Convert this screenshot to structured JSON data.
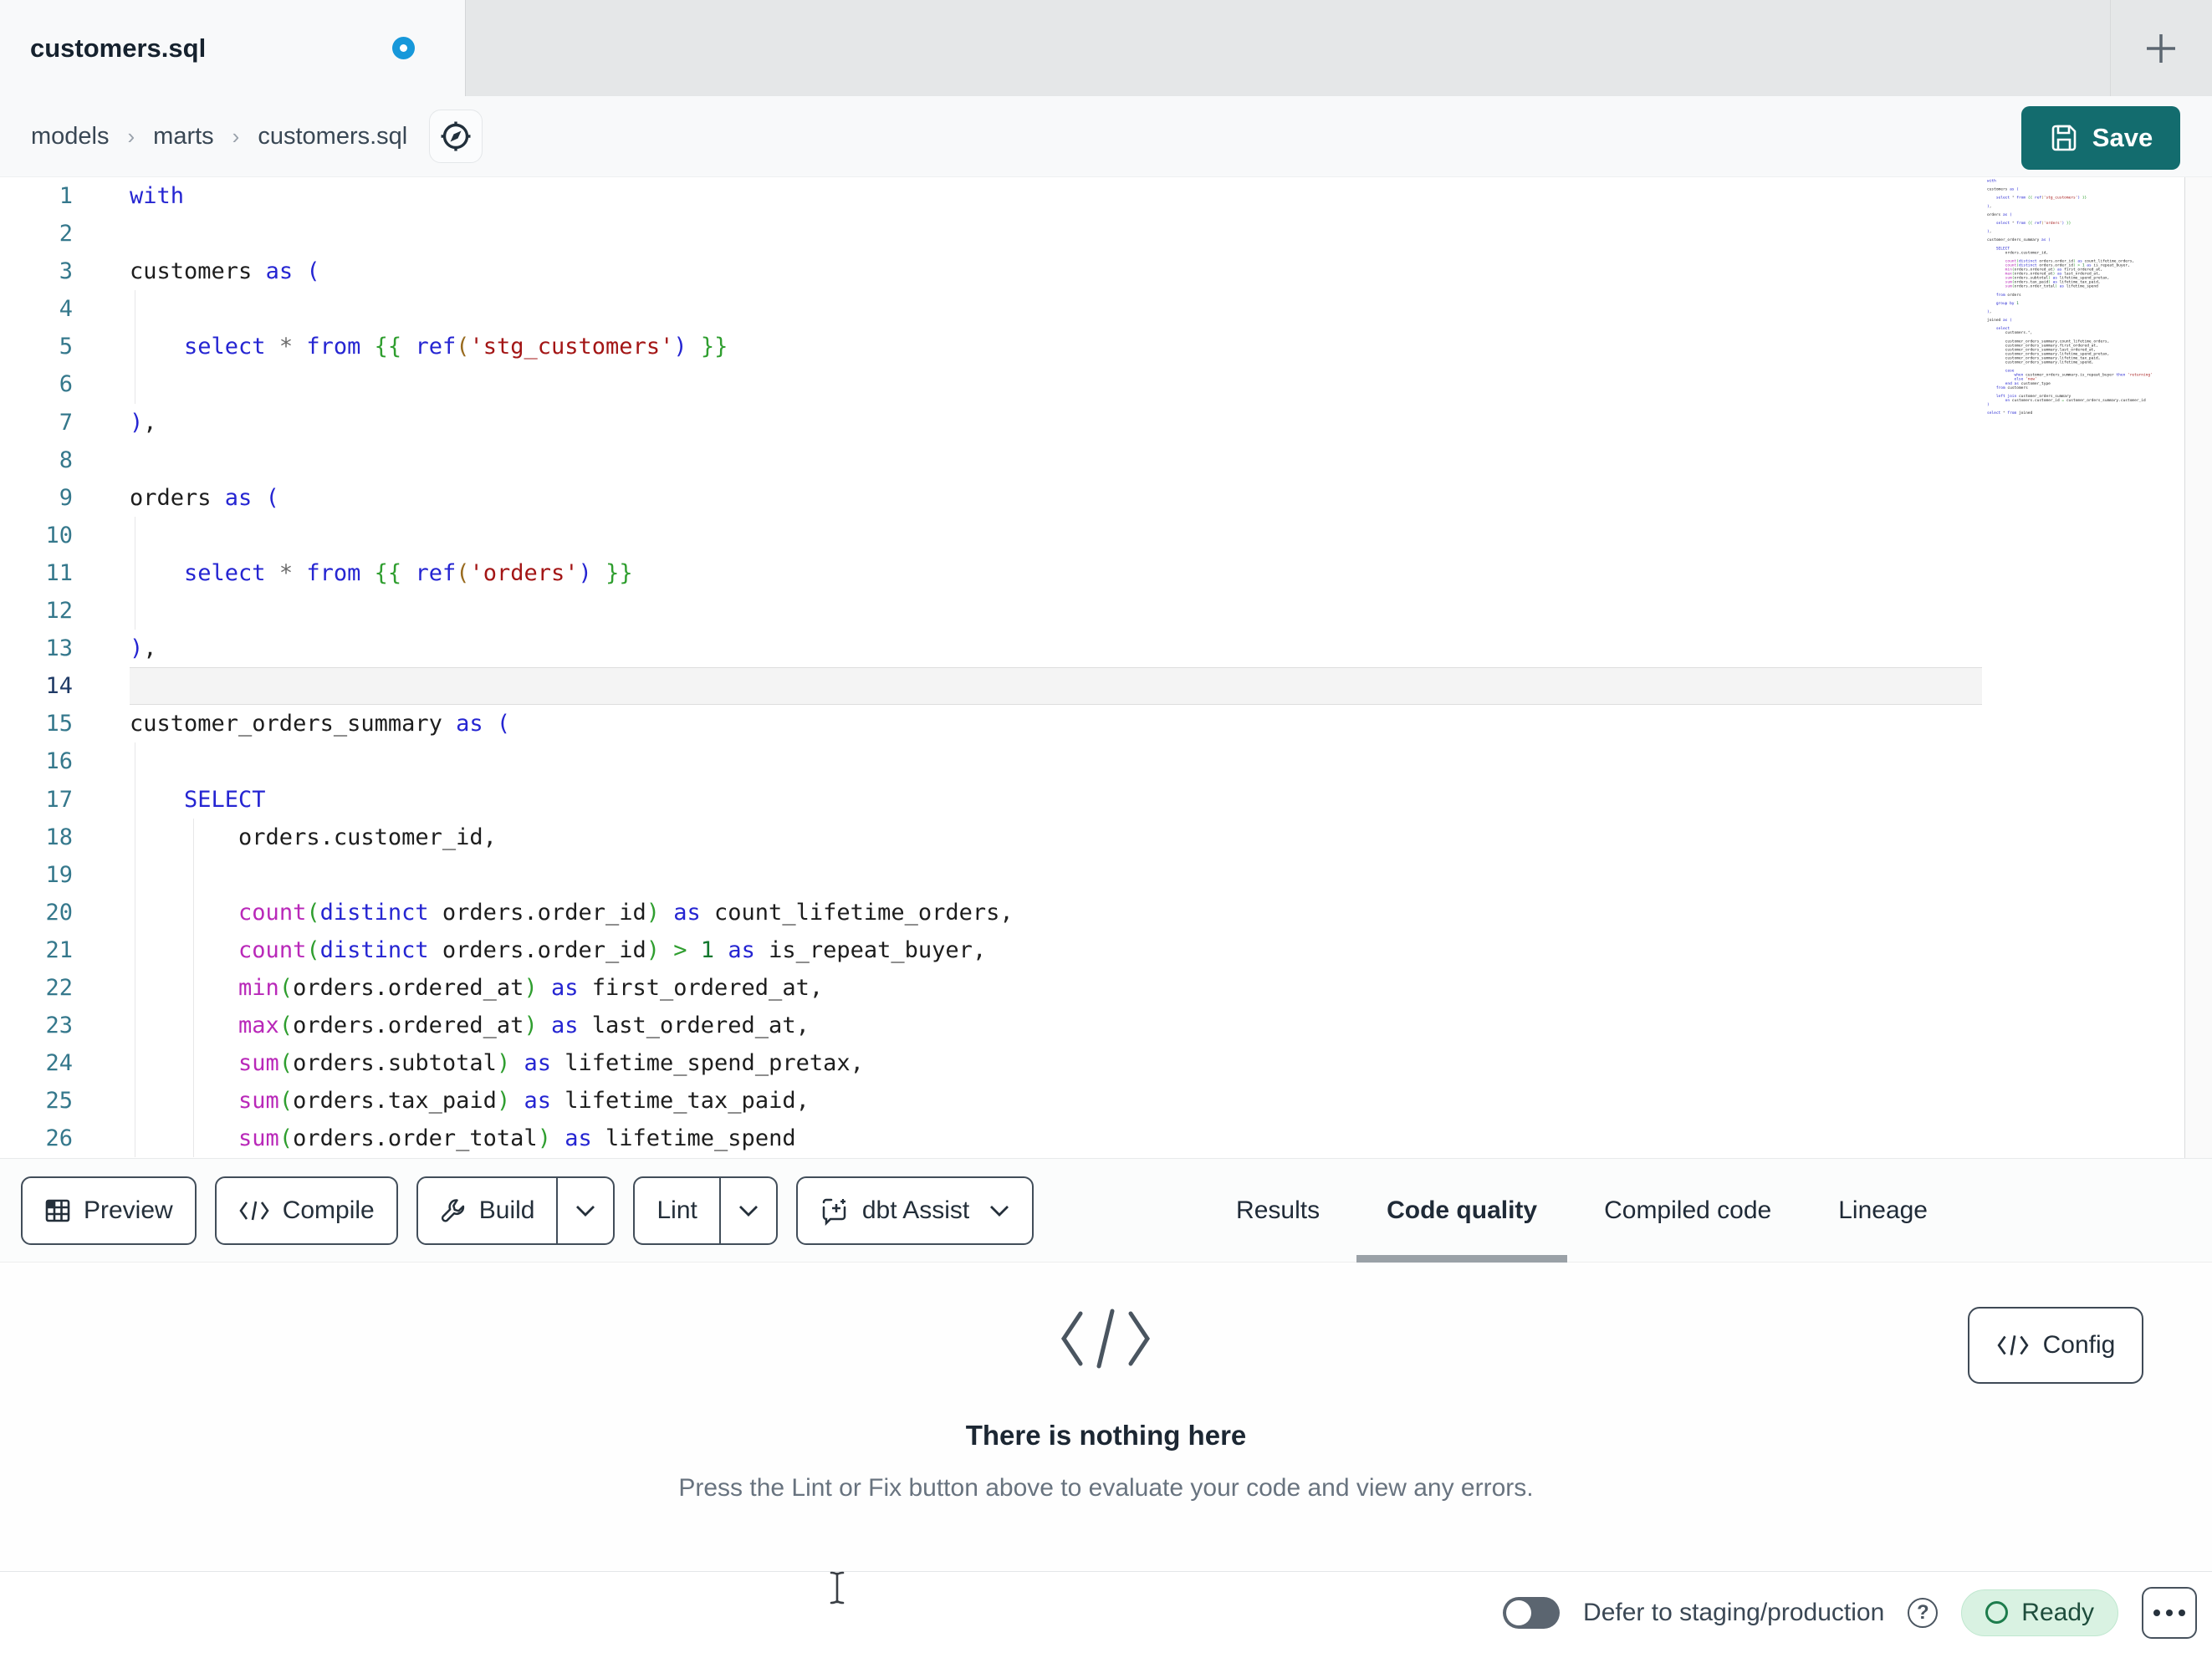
{
  "window": {
    "tab_title": "customers.sql",
    "new_tab_label": "+"
  },
  "breadcrumb": {
    "items": [
      "models",
      "marts",
      "customers.sql"
    ],
    "separator": "›"
  },
  "save_button": {
    "label": "Save"
  },
  "toolbar": {
    "preview_label": "Preview",
    "compile_label": "Compile",
    "build_label": "Build",
    "lint_label": "Lint",
    "dbt_assist_label": "dbt Assist"
  },
  "panel_tabs": [
    {
      "label": "Results",
      "active": false
    },
    {
      "label": "Code quality",
      "active": true
    },
    {
      "label": "Compiled code",
      "active": false
    },
    {
      "label": "Lineage",
      "active": false
    }
  ],
  "empty_state": {
    "icon": "code-brackets-icon",
    "title": "There is nothing here",
    "subtitle": "Press the Lint or Fix button above to evaluate your code and view any errors.",
    "config_label": "Config"
  },
  "status_bar": {
    "defer_label": "Defer to staging/production",
    "toggle_on": false,
    "ready_label": "Ready"
  },
  "colors": {
    "accent_teal": "#136c6e",
    "modified_dot_blue": "#1798da",
    "ready_pill_bg": "#d9f2e2",
    "ready_green": "#1d7c4c",
    "keyword_blue": "#2525d2",
    "function_magenta": "#b928b9",
    "string_red": "#a31515",
    "jinja_green": "#2f9e2f",
    "line_number_teal": "#35788c",
    "active_line_number": "#1f3a66"
  },
  "editor": {
    "active_line": 14,
    "visible_line_count": 26,
    "lines": [
      {
        "n": 1,
        "g": [],
        "t": [
          [
            "kw",
            "with"
          ]
        ]
      },
      {
        "n": 2,
        "g": [],
        "t": []
      },
      {
        "n": 3,
        "g": [],
        "t": [
          [
            "id",
            "customers "
          ],
          [
            "kw",
            "as ("
          ]
        ]
      },
      {
        "n": 4,
        "g": [
          0
        ],
        "t": []
      },
      {
        "n": 5,
        "g": [
          0
        ],
        "t": [
          [
            "id",
            "    "
          ],
          [
            "kw",
            "select"
          ],
          [
            "id",
            " "
          ],
          [
            "st",
            "*"
          ],
          [
            "id",
            " "
          ],
          [
            "kw",
            "from"
          ],
          [
            "id",
            " "
          ],
          [
            "jin",
            "{{"
          ],
          [
            "id",
            " "
          ],
          [
            "kw",
            "ref"
          ],
          [
            "pb",
            "("
          ],
          [
            "str",
            "'stg_customers'"
          ],
          [
            "kw",
            ")"
          ],
          [
            "id",
            " "
          ],
          [
            "jin",
            "}}"
          ]
        ]
      },
      {
        "n": 6,
        "g": [
          0
        ],
        "t": []
      },
      {
        "n": 7,
        "g": [],
        "t": [
          [
            "kw",
            ")"
          ],
          [
            "pun",
            ","
          ]
        ]
      },
      {
        "n": 8,
        "g": [],
        "t": []
      },
      {
        "n": 9,
        "g": [],
        "t": [
          [
            "id",
            "orders "
          ],
          [
            "kw",
            "as ("
          ]
        ]
      },
      {
        "n": 10,
        "g": [
          0
        ],
        "t": []
      },
      {
        "n": 11,
        "g": [
          0
        ],
        "t": [
          [
            "id",
            "    "
          ],
          [
            "kw",
            "select"
          ],
          [
            "id",
            " "
          ],
          [
            "st",
            "*"
          ],
          [
            "id",
            " "
          ],
          [
            "kw",
            "from"
          ],
          [
            "id",
            " "
          ],
          [
            "jin",
            "{{"
          ],
          [
            "id",
            " "
          ],
          [
            "kw",
            "ref"
          ],
          [
            "pb",
            "("
          ],
          [
            "str",
            "'orders'"
          ],
          [
            "kw",
            ")"
          ],
          [
            "id",
            " "
          ],
          [
            "jin",
            "}}"
          ]
        ]
      },
      {
        "n": 12,
        "g": [
          0
        ],
        "t": []
      },
      {
        "n": 13,
        "g": [],
        "t": [
          [
            "kw",
            ")"
          ],
          [
            "pun",
            ","
          ]
        ]
      },
      {
        "n": 14,
        "g": [],
        "t": []
      },
      {
        "n": 15,
        "g": [],
        "t": [
          [
            "id",
            "customer_orders_summary "
          ],
          [
            "kw",
            "as ("
          ]
        ]
      },
      {
        "n": 16,
        "g": [
          0
        ],
        "t": []
      },
      {
        "n": 17,
        "g": [
          0
        ],
        "t": [
          [
            "id",
            "    "
          ],
          [
            "kw",
            "SELECT"
          ]
        ]
      },
      {
        "n": 18,
        "g": [
          0,
          1
        ],
        "t": [
          [
            "id",
            "        orders.customer_id"
          ],
          [
            "pun",
            ","
          ]
        ]
      },
      {
        "n": 19,
        "g": [
          0,
          1
        ],
        "t": []
      },
      {
        "n": 20,
        "g": [
          0,
          1
        ],
        "t": [
          [
            "id",
            "        "
          ],
          [
            "fn",
            "count"
          ],
          [
            "pg",
            "("
          ],
          [
            "kw",
            "distinct"
          ],
          [
            "id",
            " orders.order_id"
          ],
          [
            "pg",
            ")"
          ],
          [
            "id",
            " "
          ],
          [
            "kw",
            "as"
          ],
          [
            "id",
            " count_lifetime_orders"
          ],
          [
            "pun",
            ","
          ]
        ]
      },
      {
        "n": 21,
        "g": [
          0,
          1
        ],
        "t": [
          [
            "id",
            "        "
          ],
          [
            "fn",
            "count"
          ],
          [
            "pg",
            "("
          ],
          [
            "kw",
            "distinct"
          ],
          [
            "id",
            " orders.order_id"
          ],
          [
            "pg",
            ")"
          ],
          [
            "id",
            " "
          ],
          [
            "pg",
            ">"
          ],
          [
            "id",
            " "
          ],
          [
            "num",
            "1"
          ],
          [
            "id",
            " "
          ],
          [
            "kw",
            "as"
          ],
          [
            "id",
            " is_repeat_buyer"
          ],
          [
            "pun",
            ","
          ]
        ]
      },
      {
        "n": 22,
        "g": [
          0,
          1
        ],
        "t": [
          [
            "id",
            "        "
          ],
          [
            "fn",
            "min"
          ],
          [
            "pg",
            "("
          ],
          [
            "id",
            "orders.ordered_at"
          ],
          [
            "pg",
            ")"
          ],
          [
            "id",
            " "
          ],
          [
            "kw",
            "as"
          ],
          [
            "id",
            " first_ordered_at"
          ],
          [
            "pun",
            ","
          ]
        ]
      },
      {
        "n": 23,
        "g": [
          0,
          1
        ],
        "t": [
          [
            "id",
            "        "
          ],
          [
            "fn",
            "max"
          ],
          [
            "pg",
            "("
          ],
          [
            "id",
            "orders.ordered_at"
          ],
          [
            "pg",
            ")"
          ],
          [
            "id",
            " "
          ],
          [
            "kw",
            "as"
          ],
          [
            "id",
            " last_ordered_at"
          ],
          [
            "pun",
            ","
          ]
        ]
      },
      {
        "n": 24,
        "g": [
          0,
          1
        ],
        "t": [
          [
            "id",
            "        "
          ],
          [
            "fn",
            "sum"
          ],
          [
            "pg",
            "("
          ],
          [
            "id",
            "orders.subtotal"
          ],
          [
            "pg",
            ")"
          ],
          [
            "id",
            " "
          ],
          [
            "kw",
            "as"
          ],
          [
            "id",
            " lifetime_spend_pretax"
          ],
          [
            "pun",
            ","
          ]
        ]
      },
      {
        "n": 25,
        "g": [
          0,
          1
        ],
        "t": [
          [
            "id",
            "        "
          ],
          [
            "fn",
            "sum"
          ],
          [
            "pg",
            "("
          ],
          [
            "id",
            "orders.tax_paid"
          ],
          [
            "pg",
            ")"
          ],
          [
            "id",
            " "
          ],
          [
            "kw",
            "as"
          ],
          [
            "id",
            " lifetime_tax_paid"
          ],
          [
            "pun",
            ","
          ]
        ]
      },
      {
        "n": 26,
        "g": [
          0,
          1
        ],
        "t": [
          [
            "id",
            "        "
          ],
          [
            "fn",
            "sum"
          ],
          [
            "pg",
            "("
          ],
          [
            "id",
            "orders.order_total"
          ],
          [
            "pg",
            ")"
          ],
          [
            "id",
            " "
          ],
          [
            "kw",
            "as"
          ],
          [
            "id",
            " lifetime_spend"
          ]
        ]
      },
      {
        "n": 27,
        "g": [],
        "t": []
      },
      {
        "n": 28,
        "g": [],
        "t": [
          [
            "id",
            "    "
          ],
          [
            "kw",
            "from"
          ],
          [
            "id",
            " orders"
          ]
        ]
      },
      {
        "n": 29,
        "g": [],
        "t": []
      },
      {
        "n": 30,
        "g": [],
        "t": [
          [
            "id",
            "    "
          ],
          [
            "kw",
            "group by"
          ],
          [
            "id",
            " "
          ],
          [
            "num",
            "1"
          ]
        ]
      },
      {
        "n": 31,
        "g": [],
        "t": []
      },
      {
        "n": 32,
        "g": [],
        "t": [
          [
            "kw",
            ")"
          ],
          [
            "pun",
            ","
          ]
        ]
      },
      {
        "n": 33,
        "g": [],
        "t": []
      },
      {
        "n": 34,
        "g": [],
        "t": [
          [
            "id",
            "joined "
          ],
          [
            "kw",
            "as ("
          ]
        ]
      },
      {
        "n": 35,
        "g": [],
        "t": []
      },
      {
        "n": 36,
        "g": [],
        "t": [
          [
            "id",
            "    "
          ],
          [
            "kw",
            "select"
          ]
        ]
      },
      {
        "n": 37,
        "g": [],
        "t": [
          [
            "id",
            "        customers."
          ],
          [
            "st",
            "*"
          ],
          [
            "pun",
            ","
          ]
        ]
      },
      {
        "n": 38,
        "g": [],
        "t": []
      },
      {
        "n": 39,
        "g": [],
        "t": [
          [
            "id",
            "        customer_orders_summary.count_lifetime_orders"
          ],
          [
            "pun",
            ","
          ]
        ]
      },
      {
        "n": 40,
        "g": [],
        "t": [
          [
            "id",
            "        customer_orders_summary.first_ordered_at"
          ],
          [
            "pun",
            ","
          ]
        ]
      },
      {
        "n": 41,
        "g": [],
        "t": [
          [
            "id",
            "        customer_orders_summary.last_ordered_at"
          ],
          [
            "pun",
            ","
          ]
        ]
      },
      {
        "n": 42,
        "g": [],
        "t": [
          [
            "id",
            "        customer_orders_summary.lifetime_spend_pretax"
          ],
          [
            "pun",
            ","
          ]
        ]
      },
      {
        "n": 43,
        "g": [],
        "t": [
          [
            "id",
            "        customer_orders_summary.lifetime_tax_paid"
          ],
          [
            "pun",
            ","
          ]
        ]
      },
      {
        "n": 44,
        "g": [],
        "t": [
          [
            "id",
            "        customer_orders_summary.lifetime_spend"
          ],
          [
            "pun",
            ","
          ]
        ]
      },
      {
        "n": 45,
        "g": [],
        "t": []
      },
      {
        "n": 46,
        "g": [],
        "t": [
          [
            "id",
            "        "
          ],
          [
            "kw",
            "case"
          ]
        ]
      },
      {
        "n": 47,
        "g": [],
        "t": [
          [
            "id",
            "            "
          ],
          [
            "kw",
            "when"
          ],
          [
            "id",
            " customer_orders_summary.is_repeat_buyer "
          ],
          [
            "kw",
            "then"
          ],
          [
            "id",
            " "
          ],
          [
            "str",
            "'returning'"
          ]
        ]
      },
      {
        "n": 48,
        "g": [],
        "t": [
          [
            "id",
            "            "
          ],
          [
            "kw",
            "else"
          ],
          [
            "id",
            " "
          ],
          [
            "str",
            "'new'"
          ]
        ]
      },
      {
        "n": 49,
        "g": [],
        "t": [
          [
            "id",
            "        "
          ],
          [
            "kw",
            "end as"
          ],
          [
            "id",
            " customer_type"
          ]
        ]
      },
      {
        "n": 50,
        "g": [],
        "t": [
          [
            "id",
            "    "
          ],
          [
            "kw",
            "from"
          ],
          [
            "id",
            " customers"
          ]
        ]
      },
      {
        "n": 51,
        "g": [],
        "t": []
      },
      {
        "n": 52,
        "g": [],
        "t": [
          [
            "id",
            "    "
          ],
          [
            "kw",
            "left join"
          ],
          [
            "id",
            " customer_orders_summary"
          ]
        ]
      },
      {
        "n": 53,
        "g": [],
        "t": [
          [
            "id",
            "        "
          ],
          [
            "kw",
            "on"
          ],
          [
            "id",
            " customers.customer_id "
          ],
          [
            "pg",
            "="
          ],
          [
            "id",
            " customer_orders_summary.customer_id"
          ]
        ]
      },
      {
        "n": 54,
        "g": [],
        "t": [
          [
            "kw",
            ")"
          ]
        ]
      },
      {
        "n": 55,
        "g": [],
        "t": []
      },
      {
        "n": 56,
        "g": [],
        "t": [
          [
            "kw",
            "select"
          ],
          [
            "id",
            " "
          ],
          [
            "st",
            "*"
          ],
          [
            "id",
            " "
          ],
          [
            "kw",
            "from"
          ],
          [
            "id",
            " joined"
          ]
        ]
      }
    ]
  }
}
